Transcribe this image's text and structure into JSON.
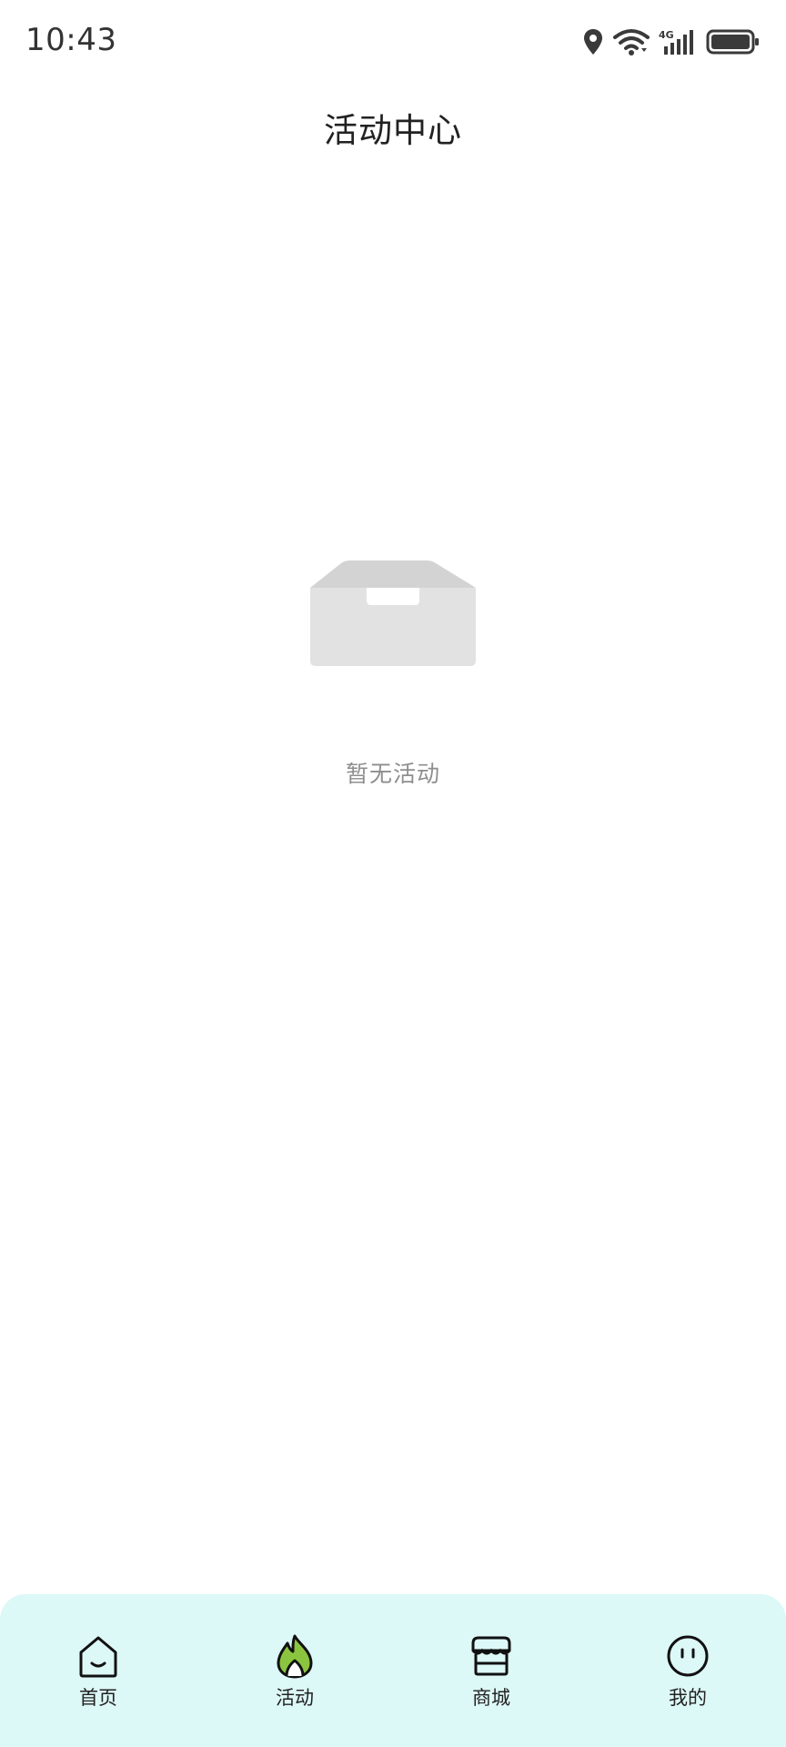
{
  "status_bar": {
    "time": "10:43",
    "network_label": "4G",
    "icons": [
      "location-icon",
      "wifi-icon",
      "cellular-signal-icon",
      "battery-icon"
    ]
  },
  "header": {
    "title": "活动中心"
  },
  "empty_state": {
    "icon": "empty-inbox-icon",
    "message": "暂无活动"
  },
  "tab_bar": {
    "background": "#dcf8f7",
    "active_color": "#8bc53f",
    "items": [
      {
        "label": "首页",
        "icon": "home-icon",
        "active": false
      },
      {
        "label": "活动",
        "icon": "flame-icon",
        "active": true
      },
      {
        "label": "商城",
        "icon": "store-icon",
        "active": false
      },
      {
        "label": "我的",
        "icon": "face-icon",
        "active": false
      }
    ]
  }
}
